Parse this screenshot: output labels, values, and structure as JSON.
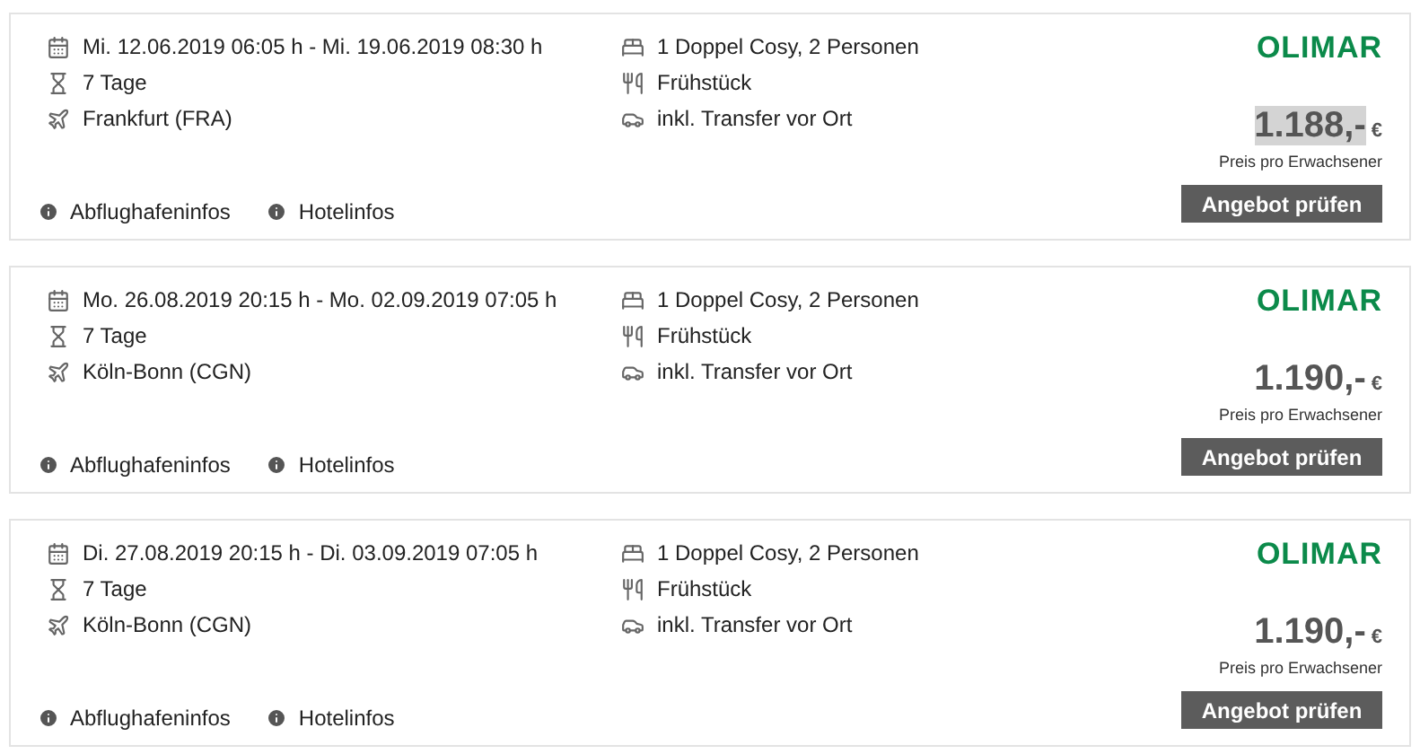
{
  "offers": [
    {
      "dates": "Mi. 12.06.2019 06:05 h - Mi. 19.06.2019 08:30 h",
      "duration": "7 Tage",
      "airport": "Frankfurt (FRA)",
      "room": "1 Doppel Cosy, 2 Personen",
      "board": "Frühstück",
      "transfer": "inkl. Transfer vor Ort",
      "links": [
        "Abflughafeninfos",
        "Hotelinfos"
      ],
      "operator": "OLIMAR",
      "price": "1.188,-",
      "currency": "€",
      "price_highlighted": true,
      "price_note": "Preis pro Erwachsener",
      "button": "Angebot prüfen"
    },
    {
      "dates": "Mo. 26.08.2019 20:15 h - Mo. 02.09.2019 07:05 h",
      "duration": "7 Tage",
      "airport": "Köln-Bonn (CGN)",
      "room": "1 Doppel Cosy, 2 Personen",
      "board": "Frühstück",
      "transfer": "inkl. Transfer vor Ort",
      "links": [
        "Abflughafeninfos",
        "Hotelinfos"
      ],
      "operator": "OLIMAR",
      "price": "1.190,-",
      "currency": "€",
      "price_highlighted": false,
      "price_note": "Preis pro Erwachsener",
      "button": "Angebot prüfen"
    },
    {
      "dates": "Di. 27.08.2019 20:15 h - Di. 03.09.2019 07:05 h",
      "duration": "7 Tage",
      "airport": "Köln-Bonn (CGN)",
      "room": "1 Doppel Cosy, 2 Personen",
      "board": "Frühstück",
      "transfer": "inkl. Transfer vor Ort",
      "links": [
        "Abflughafeninfos",
        "Hotelinfos"
      ],
      "operator": "OLIMAR",
      "price": "1.190,-",
      "currency": "€",
      "price_highlighted": false,
      "price_note": "Preis pro Erwachsener",
      "button": "Angebot prüfen"
    }
  ]
}
